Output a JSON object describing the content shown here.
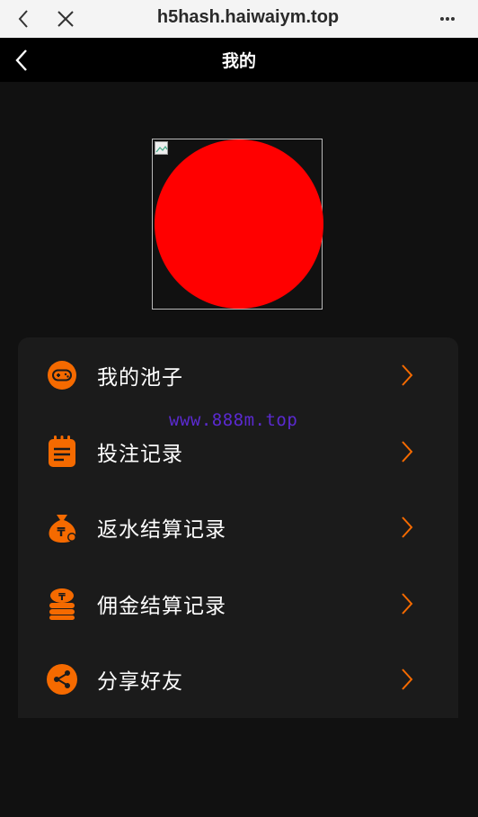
{
  "browser": {
    "url": "h5hash.haiwaiym.top",
    "back_icon": "chevron-left-icon",
    "close_icon": "close-icon",
    "more_icon": "more-dots-icon"
  },
  "header": {
    "title": "我的",
    "back_icon": "chevron-left-icon"
  },
  "avatar": {
    "circle_color": "#ff0000",
    "broken_image_icon": "broken-image-icon"
  },
  "menu": {
    "items": [
      {
        "label": "我的池子",
        "icon": "gamepad-icon"
      },
      {
        "label": "投注记录",
        "icon": "notepad-icon"
      },
      {
        "label": "返水结算记录",
        "icon": "money-bag-icon"
      },
      {
        "label": "佣金结算记录",
        "icon": "coin-stack-icon"
      },
      {
        "label": "分享好友",
        "icon": "share-icon"
      }
    ],
    "accent_color": "#f56a00"
  },
  "watermark": "www.888m.top"
}
